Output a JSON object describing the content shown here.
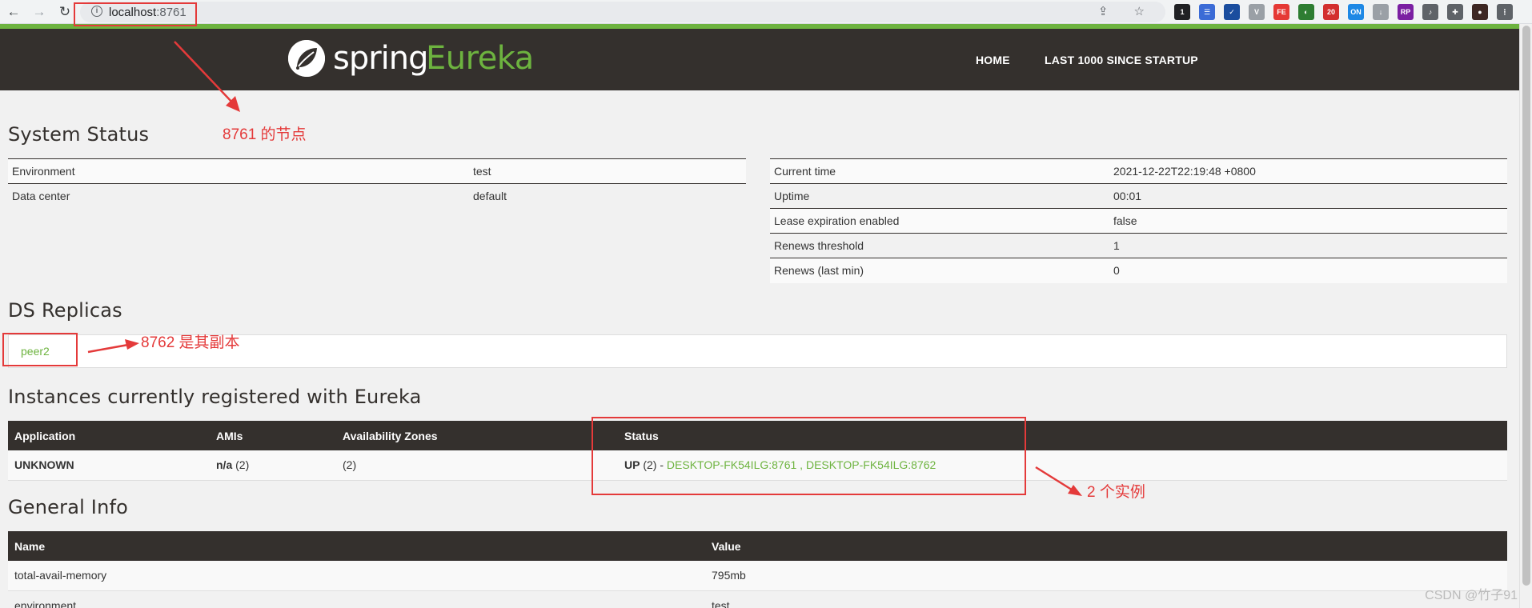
{
  "browser": {
    "url_host": "localhost",
    "url_port": ":8761",
    "omnibox_icons": "⇪ ☆",
    "extensions": [
      {
        "name": "ext-badge-1",
        "label": "1",
        "color": "#202124"
      },
      {
        "name": "ext-list",
        "label": "☰",
        "color": "#3b6bd6"
      },
      {
        "name": "ext-check",
        "label": "✓",
        "color": "#1a4d9e"
      },
      {
        "name": "ext-v",
        "label": "V",
        "color": "#9aa0a6"
      },
      {
        "name": "ext-fe",
        "label": "FE",
        "color": "#e53935"
      },
      {
        "name": "ext-circle",
        "label": "◐",
        "color": "#2e7d32"
      },
      {
        "name": "ext-20",
        "label": "20",
        "color": "#d32f2f"
      },
      {
        "name": "ext-on",
        "label": "ON",
        "color": "#1e88e5"
      },
      {
        "name": "ext-download",
        "label": "↓",
        "color": "#9aa0a6"
      },
      {
        "name": "ext-rp",
        "label": "RP",
        "color": "#7b1fa2"
      },
      {
        "name": "ext-audio",
        "label": "♪",
        "color": "#5f6368"
      },
      {
        "name": "ext-puzzle",
        "label": "✚",
        "color": "#5f6368"
      },
      {
        "name": "ext-avatar",
        "label": "●",
        "color": "#3e2723"
      },
      {
        "name": "ext-menu",
        "label": "⋮",
        "color": "#5f6368"
      }
    ]
  },
  "header": {
    "logo_spring": "spring",
    "logo_eureka": "Eureka",
    "nav": [
      "HOME",
      "LAST 1000 SINCE STARTUP"
    ]
  },
  "system_status": {
    "title": "System Status",
    "left": [
      {
        "key": "Environment",
        "value": "test"
      },
      {
        "key": "Data center",
        "value": "default"
      }
    ],
    "right": [
      {
        "key": "Current time",
        "value": "2021-12-22T22:19:48 +0800"
      },
      {
        "key": "Uptime",
        "value": "00:01"
      },
      {
        "key": "Lease expiration enabled",
        "value": "false"
      },
      {
        "key": "Renews threshold",
        "value": "1"
      },
      {
        "key": "Renews (last min)",
        "value": "0"
      }
    ]
  },
  "ds_replicas": {
    "title": "DS Replicas",
    "replica": "peer2"
  },
  "instances": {
    "title": "Instances currently registered with Eureka",
    "headers": [
      "Application",
      "AMIs",
      "Availability Zones",
      "Status"
    ],
    "row": {
      "application": "UNKNOWN",
      "amis_bold": "n/a",
      "amis_count": " (2)",
      "zones": "(2)",
      "status_prefix": "UP",
      "status_count": " (2) - ",
      "instance1": "DESKTOP-FK54ILG:8761",
      "separator": " , ",
      "instance2": "DESKTOP-FK54ILG:8762"
    }
  },
  "general_info": {
    "title": "General Info",
    "headers": [
      "Name",
      "Value"
    ],
    "rows": [
      {
        "name": "total-avail-memory",
        "value": "795mb"
      },
      {
        "name": "environment",
        "value": "test"
      }
    ]
  },
  "annotations": {
    "node": "8761 的节点",
    "replica": "8762 是其副本",
    "instances": "2 个实例"
  },
  "watermark": "CSDN @竹子91",
  "colors": {
    "accent": "#6db33f",
    "header_bg": "#34302d",
    "annotation": "#e43a3a"
  }
}
